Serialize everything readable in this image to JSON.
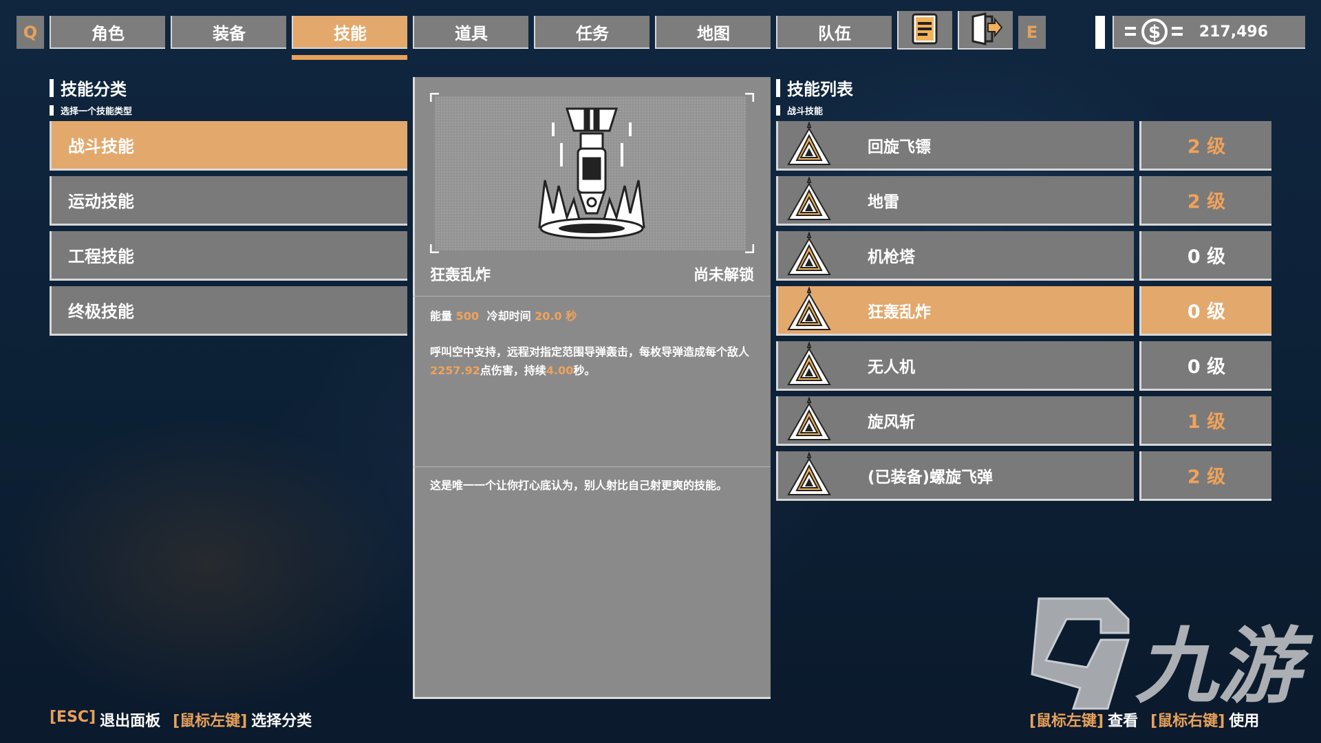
{
  "top_bar": {
    "left_key": "Q",
    "right_key": "E",
    "tabs": [
      {
        "label": "角色"
      },
      {
        "label": "装备"
      },
      {
        "label": "技能"
      },
      {
        "label": "道具"
      },
      {
        "label": "任务"
      },
      {
        "label": "地图"
      },
      {
        "label": "队伍"
      }
    ],
    "active_tab": "技能",
    "money_value": "217,496",
    "icons": [
      "document-icon",
      "exit-door-icon",
      "money-icon"
    ]
  },
  "category_panel": {
    "title": "技能分类",
    "subtitle": "选择一个技能类型",
    "items": [
      {
        "label": "战斗技能"
      },
      {
        "label": "运动技能"
      },
      {
        "label": "工程技能"
      },
      {
        "label": "终极技能"
      }
    ],
    "selected": "战斗技能"
  },
  "detail_panel": {
    "skill_name": "狂轰乱炸",
    "status": "尚未解锁",
    "energy_label": "能量",
    "energy_value": "500",
    "cooldown_label": "冷却时间",
    "cooldown_value": "20.0 秒",
    "desc_part1": "呼叫空中支持，远程对指定范围导弹轰击，每枚导弹造成每个敌人",
    "damage_value": "2257.92",
    "desc_part2": "点伤害，持续",
    "duration_value": "4.00",
    "desc_part3": "秒。",
    "flavor": "这是唯一一个让你打心底认为，别人射比自己射更爽的技能。",
    "icon": "missile-strike-icon"
  },
  "skill_list": {
    "title": "技能列表",
    "subtitle": "战斗技能",
    "rows": [
      {
        "name": "回旋飞镖",
        "level": "2 级",
        "level_color": "orange"
      },
      {
        "name": "地雷",
        "level": "2 级",
        "level_color": "orange"
      },
      {
        "name": "机枪塔",
        "level": "0 级",
        "level_color": "white"
      },
      {
        "name": "狂轰乱炸",
        "level": "0 级",
        "level_color": "white"
      },
      {
        "name": "无人机",
        "level": "0 级",
        "level_color": "white"
      },
      {
        "name": "旋风斩",
        "level": "1 级",
        "level_color": "orange"
      },
      {
        "name": "(已装备)螺旋飞弹",
        "level": "2 级",
        "level_color": "orange"
      }
    ],
    "selected": "狂轰乱炸",
    "row_icon": "rank-chevron-icon"
  },
  "footer": {
    "left": [
      {
        "key": "[ESC]",
        "action": "退出面板"
      },
      {
        "key": "[鼠标左键]",
        "action": "选择分类"
      }
    ],
    "right": [
      {
        "key": "[鼠标左键]",
        "action": "查看"
      },
      {
        "key": "[鼠标右键]",
        "action": "使用"
      }
    ]
  },
  "watermark": {
    "text": "九游"
  },
  "colors": {
    "accent": "#e3a86c",
    "orange_text": "#f0a35a",
    "panel_gray": "#7a7a7a"
  }
}
